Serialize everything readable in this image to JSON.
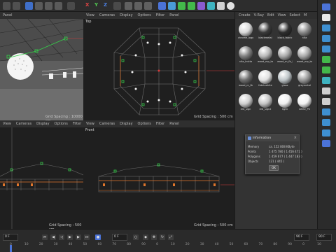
{
  "colors": {
    "accent": "#4b73d8",
    "selection_orange": "#e0762c",
    "handle_green": "#35d24a",
    "axis_red": "#d63a3a"
  },
  "toolbar": {
    "icons": [
      "undo-icon",
      "redo-icon",
      "move-tool-icon",
      "scale-tool-icon",
      "rotate-tool-icon",
      "axis-x-icon",
      "axis-y-icon",
      "axis-z-icon",
      "coordinate-system-icon",
      "render-view-icon",
      "render-picture-queue-icon",
      "render-settings-icon",
      "cube-primitive-icon",
      "pen-tool-icon",
      "subdivision-icon",
      "cloner-icon",
      "deformer-icon",
      "floor-icon",
      "camera-icon",
      "light-icon"
    ],
    "axis_x": "X",
    "axis_y": "Y",
    "axis_z": "Z"
  },
  "viewports": {
    "menu": [
      "View",
      "Cameras",
      "Display",
      "Options",
      "Filter",
      "Panel"
    ],
    "perspective": {
      "menu_first": "Panel",
      "grid_spacing": "Grid Spacing : 10000 cm"
    },
    "top": {
      "title": "Top",
      "grid_spacing": "Grid Spacing : 500 cm"
    },
    "right": {
      "title": "",
      "grid_spacing": "Grid Spacing : 500 cm"
    },
    "front": {
      "title": "Front",
      "grid_spacing": "Grid Spacing : 500 cm"
    }
  },
  "materials_panel": {
    "menu": [
      "Create",
      "V-Ray",
      "Edit",
      "View",
      "Select",
      "M"
    ],
    "materials": [
      {
        "name": "chrome_logo",
        "color": "#d9d9d9"
      },
      {
        "name": "blackmetal",
        "color": "#3a3a3a"
      },
      {
        "name": "black_fabric",
        "color": "#2e2e2e"
      },
      {
        "name": "nita",
        "color": "#8a8a8a"
      },
      {
        "name": "nita_trutta",
        "color": "#7e7e7e"
      },
      {
        "name": "wood_mp_bar",
        "color": "#b8b8b8"
      },
      {
        "name": "wood_m_fb_b",
        "color": "#aaaaaa"
      },
      {
        "name": "wood_mp_bar",
        "color": "#a9a9a9"
      },
      {
        "name": "wood_m_fb",
        "color": "#6f6f6f"
      },
      {
        "name": "fabricwhite",
        "color": "#e2e2e2"
      },
      {
        "name": "glass",
        "color": "#bfc6c9"
      },
      {
        "name": "greymetal",
        "color": "#9b9b9b"
      },
      {
        "name": "red_sign",
        "color": "#cfcfcf"
      },
      {
        "name": "red_sign2",
        "color": "#c4c4c4"
      },
      {
        "name": "light",
        "color": "#efefef"
      },
      {
        "name": "white_PS",
        "color": "#f2f2f2"
      }
    ]
  },
  "info_dialog": {
    "title": "Information",
    "rows": [
      {
        "label": "Memory",
        "value": "ca. 152 808 KByte"
      },
      {
        "label": "Points",
        "value": "1 475 780 ( 1 456 471 )"
      },
      {
        "label": "Polygons",
        "value": "1 459 677 ( 1 447 183 )"
      },
      {
        "label": "Objects",
        "value": "121 ( 445 )"
      }
    ],
    "ok_label": "OK",
    "close_glyph": "×"
  },
  "timeline": {
    "ruler": [
      "0",
      "10",
      "20",
      "30",
      "40",
      "50",
      "60",
      "70",
      "80",
      "90",
      "0",
      "10",
      "20",
      "30",
      "40",
      "50",
      "60",
      "70",
      "80",
      "90",
      "0",
      "10"
    ],
    "start_frame": "0 F",
    "current_frame": "0 F",
    "end_frame": "90 F",
    "right_frame": "90 F",
    "playback_progress": 0.0
  }
}
